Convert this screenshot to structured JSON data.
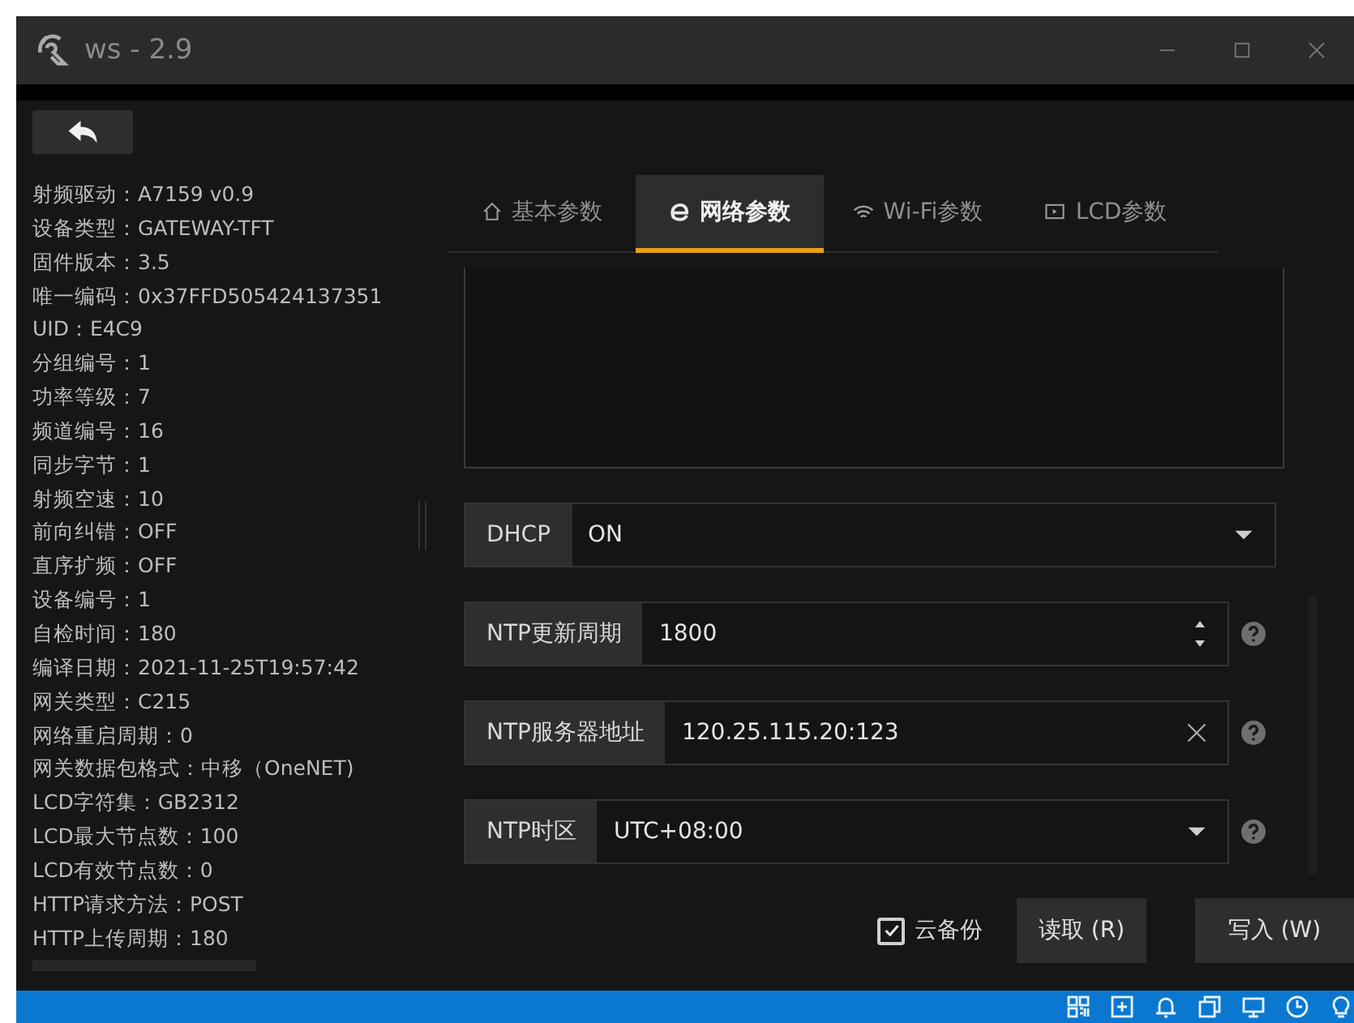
{
  "window": {
    "title": "ws - 2.9"
  },
  "info": [
    "射频驱动：A7159 v0.9",
    "设备类型：GATEWAY-TFT",
    "固件版本：3.5",
    "唯一编码：0x37FFD505424137351",
    "UID：E4C9",
    "分组编号：1",
    "功率等级：7",
    "频道编号：16",
    "同步字节：1",
    "射频空速：10",
    "前向纠错：OFF",
    "直序扩频：OFF",
    "设备编号：1",
    "自检时间：180",
    "编译日期：2021-11-25T19:57:42",
    "网关类型：C215",
    "网络重启周期：0",
    "网关数据包格式：中移（OneNET)",
    "LCD字符集：GB2312",
    "LCD最大节点数：100",
    "LCD有效节点数：0",
    "HTTP请求方法：POST",
    "HTTP上传周期：180"
  ],
  "tabs": [
    {
      "label": "基本参数",
      "selected": false
    },
    {
      "label": "网络参数",
      "selected": true
    },
    {
      "label": "Wi-Fi参数",
      "selected": false
    },
    {
      "label": "LCD参数",
      "selected": false
    }
  ],
  "fields": [
    {
      "kind": "select",
      "label": "DHCP",
      "value": "ON",
      "help": false
    },
    {
      "kind": "spin",
      "label": "NTP更新周期",
      "value": "1800",
      "help": true
    },
    {
      "kind": "clear",
      "label": "NTP服务器地址",
      "value": "120.25.115.20:123",
      "help": true
    },
    {
      "kind": "select",
      "label": "NTP时区",
      "value": "UTC+08:00",
      "help": true
    }
  ],
  "cloud_backup": {
    "label": "云备份",
    "checked": true
  },
  "buttons": [
    "读取 (R)",
    "写入 (W)"
  ]
}
